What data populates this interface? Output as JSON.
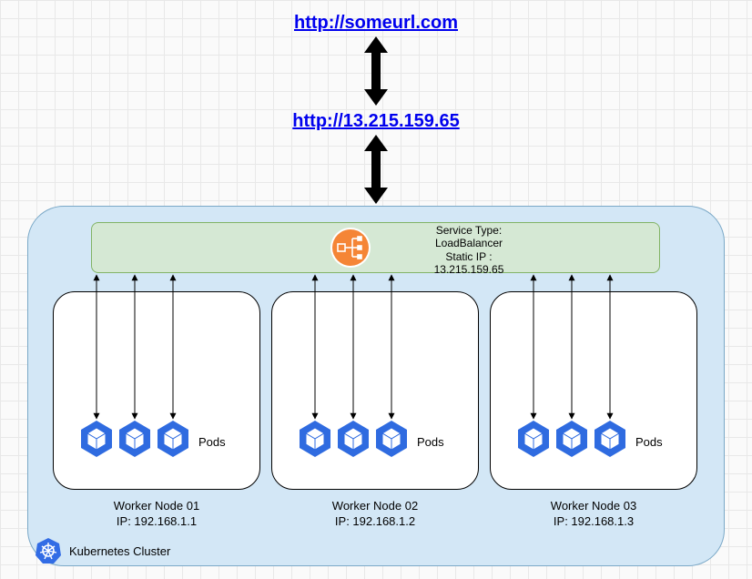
{
  "urls": {
    "domain": "http://someurl.com",
    "ip": "http://13.215.159.65"
  },
  "service": {
    "line1": "Service Type:",
    "line2": "LoadBalancer",
    "line3": "Static IP :",
    "line4": "13.215.159.65"
  },
  "pods_label": "Pods",
  "nodes": [
    {
      "name": "Worker Node 01",
      "ip": "IP: 192.168.1.1"
    },
    {
      "name": "Worker Node 02",
      "ip": "IP: 192.168.1.2"
    },
    {
      "name": "Worker Node 03",
      "ip": "IP: 192.168.1.3"
    }
  ],
  "cluster_label": "Kubernetes Cluster"
}
